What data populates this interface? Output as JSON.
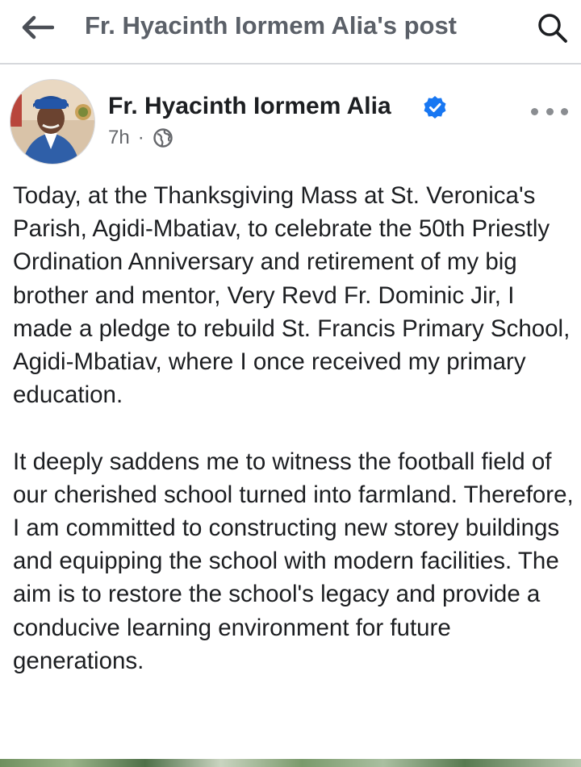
{
  "topbar": {
    "title": "Fr. Hyacinth Iormem Alia's post",
    "back_icon": "arrow-left-icon",
    "search_icon": "search-icon"
  },
  "post": {
    "author": "Fr. Hyacinth Iormem Alia",
    "verified_icon": "verified-badge-icon",
    "time": "7h",
    "separator": "·",
    "audience_icon": "globe-icon",
    "more_icon": "more-horizontal-icon",
    "paragraphs": [
      "Today, at the Thanksgiving Mass at St. Veronica's Parish, Agidi-Mbatiav, to celebrate the 50th Priestly Ordination Anniversary and retirement of my big brother and mentor, Very Revd Fr. Dominic Jir, I made a pledge to rebuild St. Francis Primary School, Agidi-Mbatiav, where I once received my primary education.",
      "It deeply saddens me to witness the football field of our cherished school turned into farmland. Therefore, I am committed to constructing new storey buildings and equipping the school with modern facilities. The aim is to restore the school's legacy and provide a conducive learning environment for future generations."
    ]
  },
  "colors": {
    "verified": "#1877f2",
    "meta_text": "#65676b",
    "title_text": "#5b6068"
  }
}
